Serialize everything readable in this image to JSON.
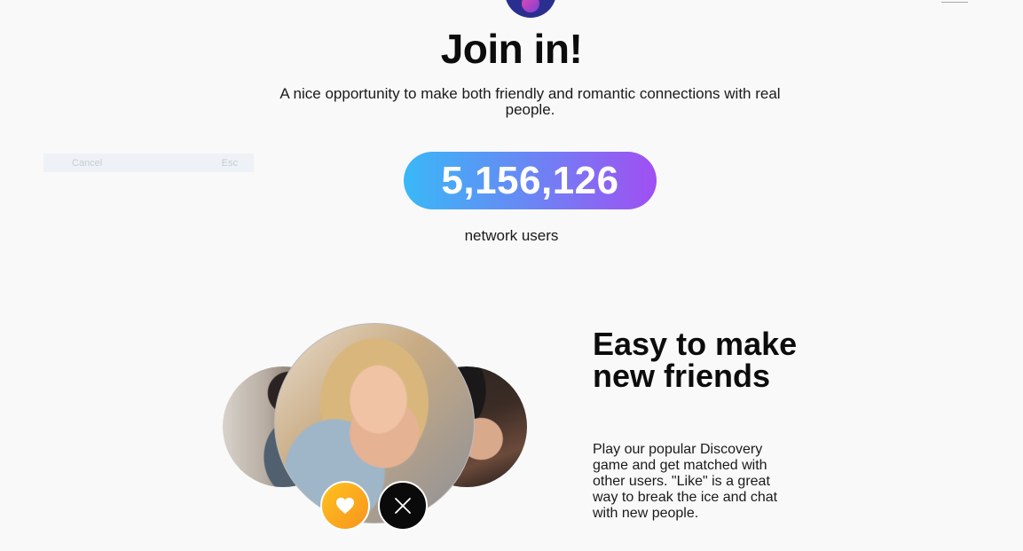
{
  "header": {
    "title": "Join in!",
    "subtitle": "A nice opportunity to make both friendly and romantic connections with real people."
  },
  "cancel_bar": {
    "cancel_label": "Cancel",
    "shortcut_label": "Esc"
  },
  "stats": {
    "user_count": "5,156,126",
    "caption": "network users"
  },
  "feature": {
    "title": "Easy to make new friends",
    "description": "Play our popular Discovery game and get matched with other users. \"Like\" is a great way to break the ice and chat with new people."
  },
  "actions": {
    "like_icon": "heart-icon",
    "dislike_icon": "close-icon"
  },
  "colors": {
    "pill_gradient_start": "#39b8f7",
    "pill_gradient_end": "#a14ff2",
    "like_start": "#ffc21f",
    "like_end": "#f7941d",
    "dislike": "#0a0a0a",
    "logo": "#2a2f8f"
  }
}
